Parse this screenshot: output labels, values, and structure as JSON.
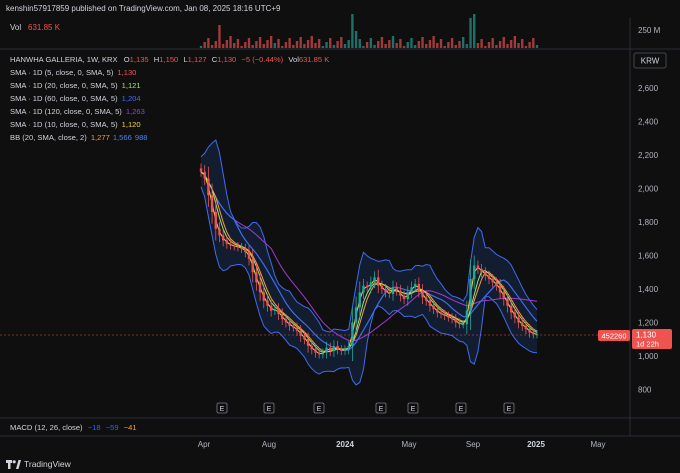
{
  "header": {
    "publish_line": "kenshin57917859 published on TradingView.com, Jan 08, 2025 18:16 UTC+9"
  },
  "volume": {
    "label": "Vol",
    "value": "631.85 K",
    "axis_tick": "250 M"
  },
  "currency": "KRW",
  "legend": {
    "symbol": "HANWHA GALLERIA, 1W, KRX",
    "ohlc": [
      {
        "key": "O",
        "value": "1,135"
      },
      {
        "key": "H",
        "value": "1,150"
      },
      {
        "key": "L",
        "value": "1,127"
      },
      {
        "key": "C",
        "value": "1,130"
      }
    ],
    "change": "−5 (−0.44%)",
    "vol_key": "Vol",
    "vol_value": "631.85 K",
    "indicators": [
      {
        "label": "SMA · 1D (5, close, 0, SMA, 5)",
        "value": "1,130",
        "color": "#f7525f"
      },
      {
        "label": "SMA · 1D (20, close, 0, SMA, 5)",
        "value": "1,121",
        "color": "#a5e36d"
      },
      {
        "label": "SMA · 1D (60, close, 0, SMA, 5)",
        "value": "1,204",
        "color": "#3f6cf0"
      },
      {
        "label": "SMA · 1D (120, close, 0, SMA, 5)",
        "value": "1,263",
        "color": "#9c3ed2"
      },
      {
        "label": "SMA · 1D (10, close, 0, SMA, 5)",
        "value": "1,120",
        "color": "#f5d63d"
      },
      {
        "label": "BB (20, SMA, close, 2)",
        "value": "1,277",
        "color": "#f59d3b",
        "extra": [
          "1,566",
          "988"
        ],
        "extra_color": "#4f7ff0"
      }
    ]
  },
  "price_axis": {
    "ticks": [
      "2,600",
      "2,400",
      "2,200",
      "2,000",
      "1,800",
      "1,600",
      "1,400",
      "1,200",
      "1,000",
      "800"
    ]
  },
  "price_tag": {
    "id": "452260",
    "price": "1,130",
    "countdown": "1d 22h"
  },
  "earnings_marker": "E",
  "x_axis": {
    "ticks": [
      "Apr",
      "Aug",
      "2024",
      "May",
      "Sep",
      "2025",
      "May"
    ]
  },
  "macd": {
    "label": "MACD (12, 26, close)",
    "values": [
      "−18",
      "−59",
      "−41"
    ],
    "colors": [
      "#2962ff",
      "#2962ff",
      "#f59d3b"
    ]
  },
  "footer": {
    "brand": "TradingView"
  },
  "colors": {
    "up": "#26a69a",
    "down": "#ef5350",
    "band": "#1e3a6e",
    "background": "#0f0f10"
  },
  "chart_data": {
    "type": "candlestick",
    "ylim": [
      700,
      2700
    ],
    "closes": [
      2100,
      2060,
      1960,
      1860,
      1760,
      1720,
      1690,
      1670,
      1660,
      1655,
      1650,
      1640,
      1620,
      1580,
      1500,
      1440,
      1380,
      1330,
      1300,
      1270,
      1280,
      1250,
      1220,
      1200,
      1180,
      1170,
      1150,
      1120,
      1100,
      1060,
      1040,
      1020,
      1010,
      1020,
      1050,
      1030,
      1060,
      1040,
      1030,
      1040,
      1060,
      1200,
      1290,
      1380,
      1420,
      1410,
      1440,
      1470,
      1420,
      1400,
      1380,
      1370,
      1410,
      1390,
      1360,
      1340,
      1380,
      1410,
      1430,
      1390,
      1350,
      1330,
      1300,
      1280,
      1260,
      1250,
      1240,
      1230,
      1220,
      1200,
      1190,
      1190,
      1270,
      1460,
      1540,
      1520,
      1500,
      1480,
      1460,
      1440,
      1420,
      1380,
      1340,
      1300,
      1260,
      1230,
      1200,
      1180,
      1160,
      1140,
      1130,
      1130
    ]
  }
}
